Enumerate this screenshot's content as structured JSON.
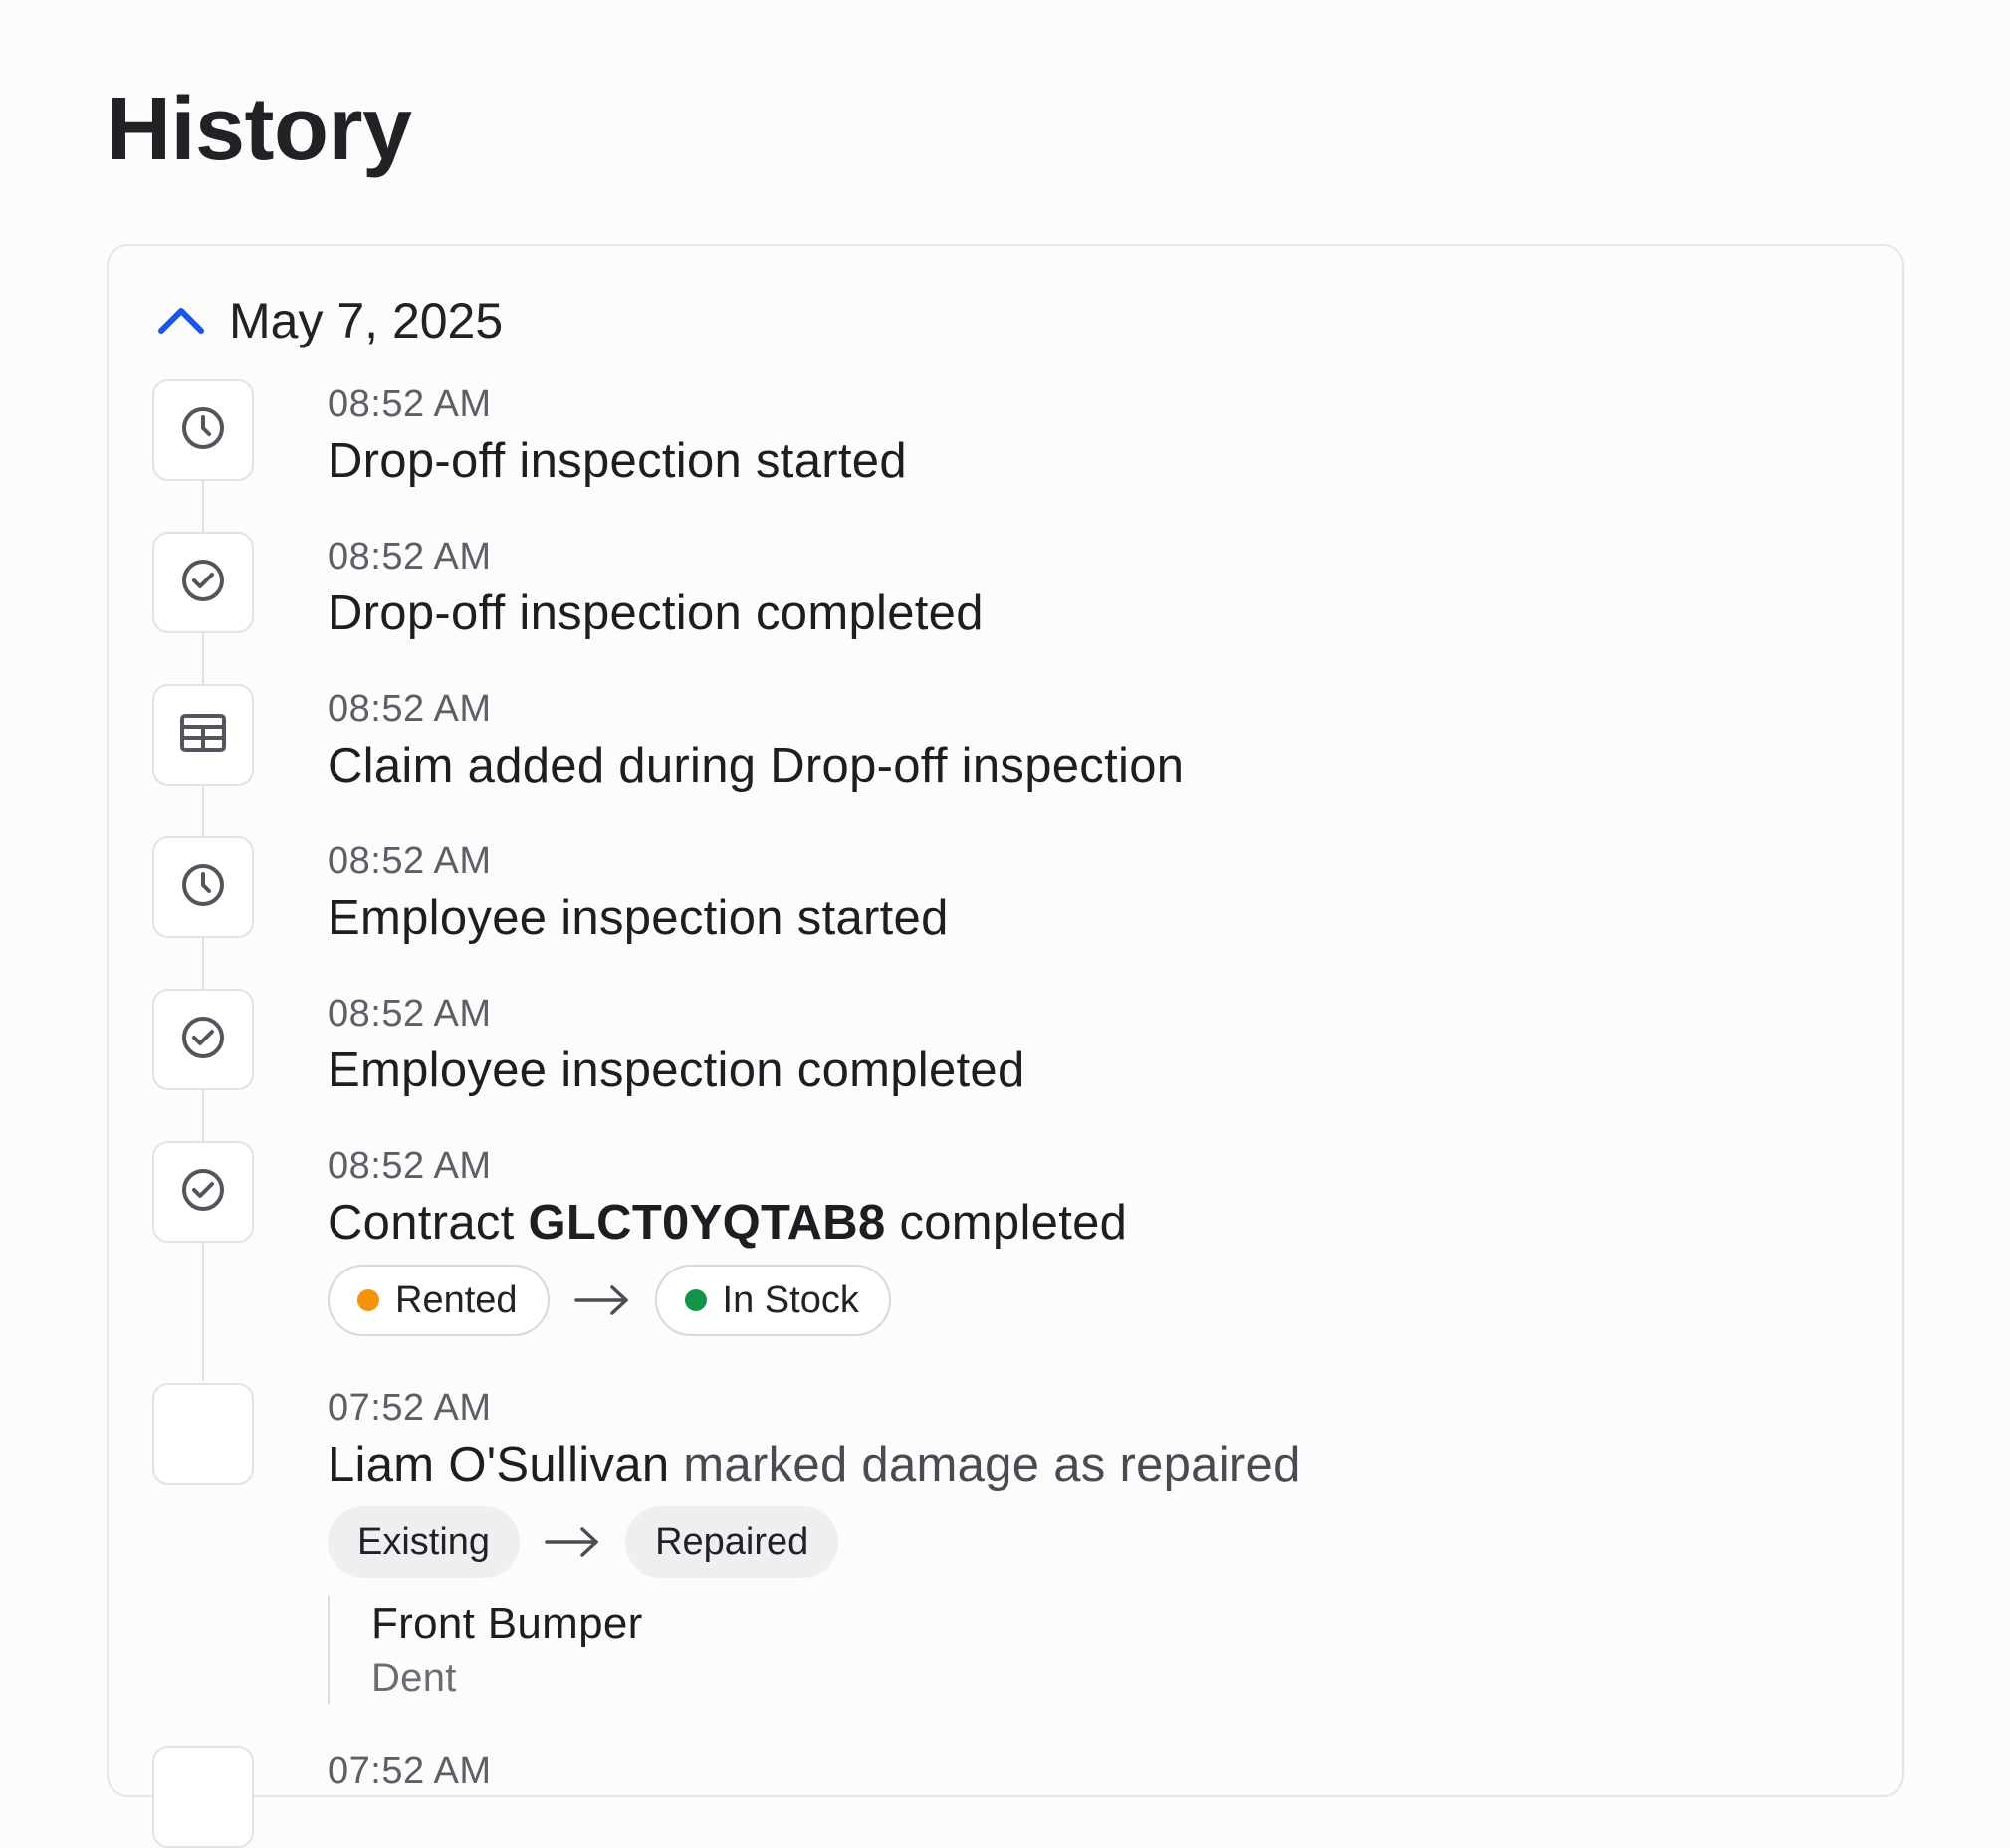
{
  "page": {
    "title": "History"
  },
  "colors": {
    "accent": "#1a56ea",
    "rented_dot": "#f5920b",
    "in_stock_dot": "#13924a",
    "icon_stroke": "#55535b"
  },
  "history": {
    "day": {
      "date": "May 7, 2025",
      "expanded": true,
      "toggle_icon": "chevron-up-icon"
    },
    "events": [
      {
        "time": "08:52 AM",
        "text": "Drop-off inspection started",
        "icon": "clock-icon"
      },
      {
        "time": "08:52 AM",
        "text": "Drop-off inspection completed",
        "icon": "check-circle-icon"
      },
      {
        "time": "08:52 AM",
        "text": "Claim added during Drop-off inspection",
        "icon": "table-icon"
      },
      {
        "time": "08:52 AM",
        "text": "Employee inspection started",
        "icon": "clock-icon"
      },
      {
        "time": "08:52 AM",
        "text": "Employee inspection completed",
        "icon": "check-circle-icon"
      },
      {
        "time": "08:52 AM",
        "text_prefix": "Contract ",
        "contract_id": "GLCT0YQTAB8",
        "text_suffix": " completed",
        "icon": "check-circle-icon",
        "status_from": "Rented",
        "status_to": "In Stock"
      },
      {
        "time": "07:52 AM",
        "user": "Liam O'Sullivan",
        "action": " marked damage as repaired",
        "icon": "avatar",
        "state_from": "Existing",
        "state_to": "Repaired",
        "damage_part": "Front Bumper",
        "damage_type": "Dent"
      },
      {
        "time": "07:52 AM"
      }
    ]
  }
}
